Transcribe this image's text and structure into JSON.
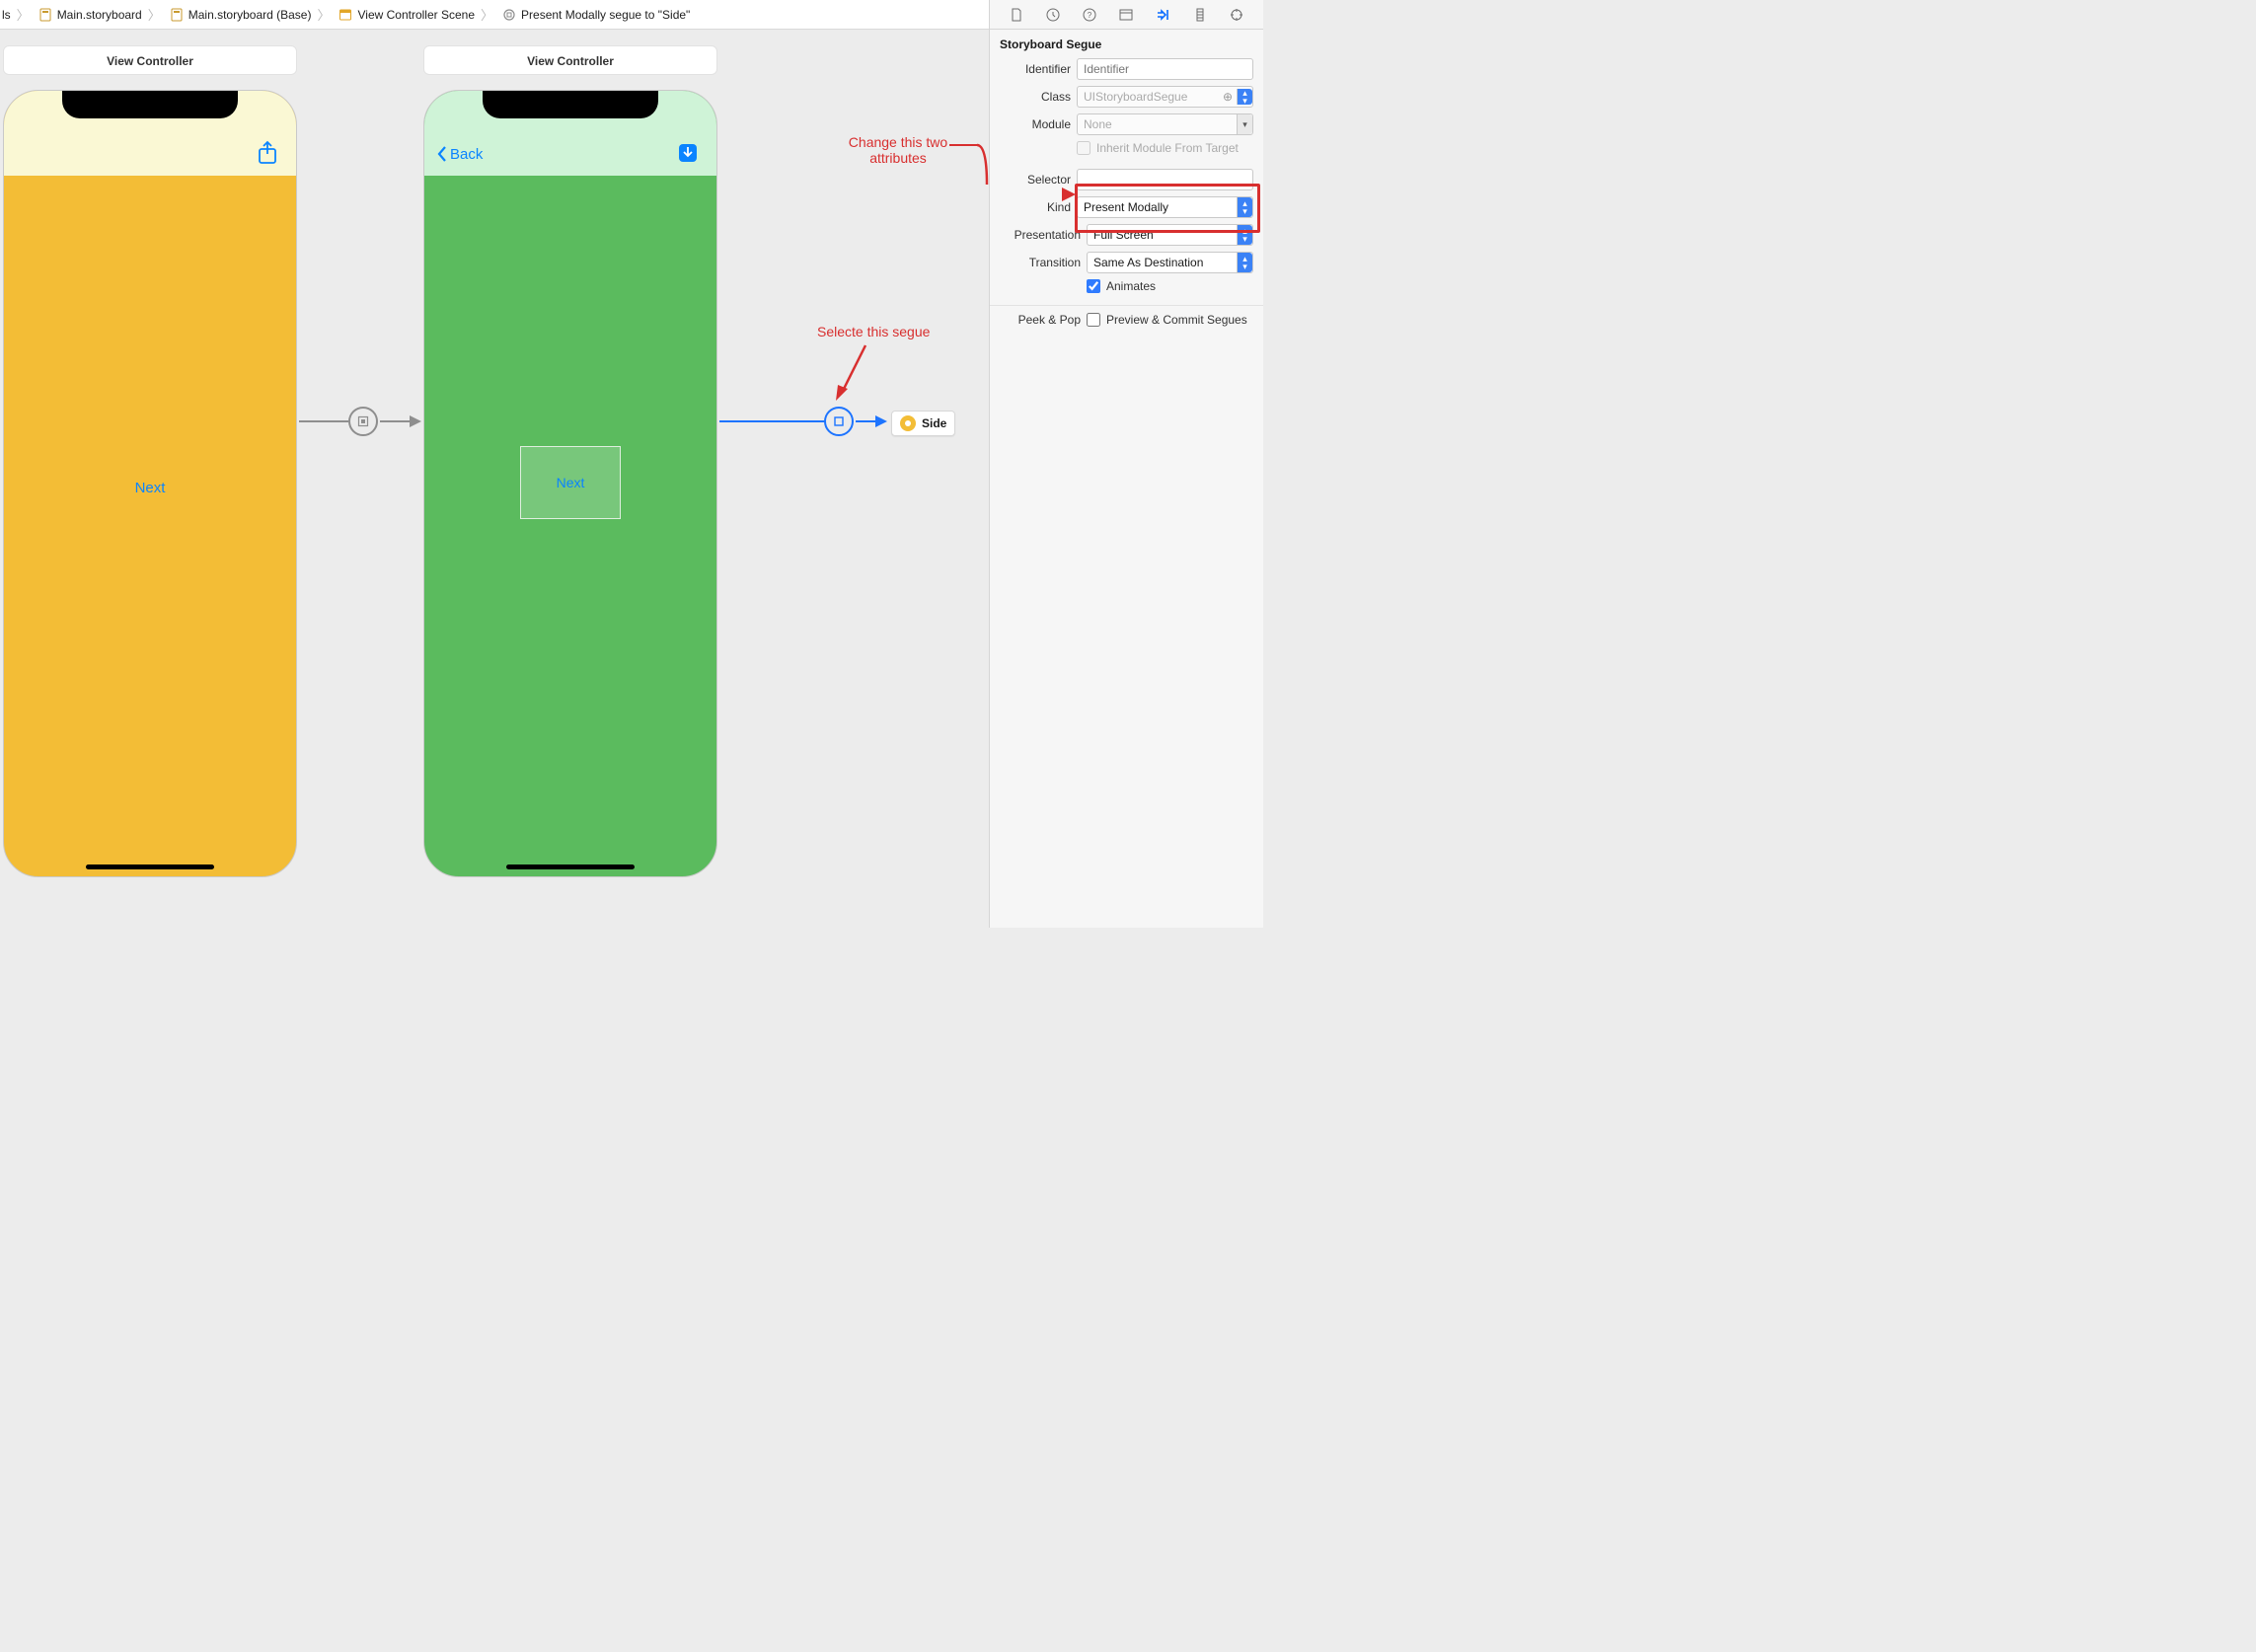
{
  "breadcrumbs": {
    "items": [
      {
        "label": "ls",
        "icon": "none"
      },
      {
        "label": "Main.storyboard",
        "icon": "storyboard-file"
      },
      {
        "label": "Main.storyboard (Base)",
        "icon": "storyboard-file"
      },
      {
        "label": "View Controller Scene",
        "icon": "scene"
      },
      {
        "label": "Present Modally segue to \"Side\"",
        "icon": "segue"
      }
    ]
  },
  "vc1": {
    "title": "View Controller",
    "next_label": "Next"
  },
  "vc2": {
    "title": "View Controller",
    "back_label": "Back",
    "container_label": "Next"
  },
  "side_ref": {
    "label": "Side"
  },
  "annotations": {
    "change_two": "Change this two attributes",
    "select_segue": "Selecte this segue"
  },
  "inspector": {
    "section": "Storyboard Segue",
    "identifier_label": "Identifier",
    "identifier_placeholder": "Identifier",
    "class_label": "Class",
    "class_value": "UIStoryboardSegue",
    "module_label": "Module",
    "module_value": "None",
    "inherit_label": "Inherit Module From Target",
    "selector_label": "Selector",
    "kind_label": "Kind",
    "kind_value": "Present Modally",
    "presentation_label": "Presentation",
    "presentation_value": "Full Screen",
    "transition_label": "Transition",
    "transition_value": "Same As Destination",
    "animates_label": "Animates",
    "peekpop_label": "Peek & Pop",
    "peekpop_option": "Preview & Commit Segues"
  }
}
